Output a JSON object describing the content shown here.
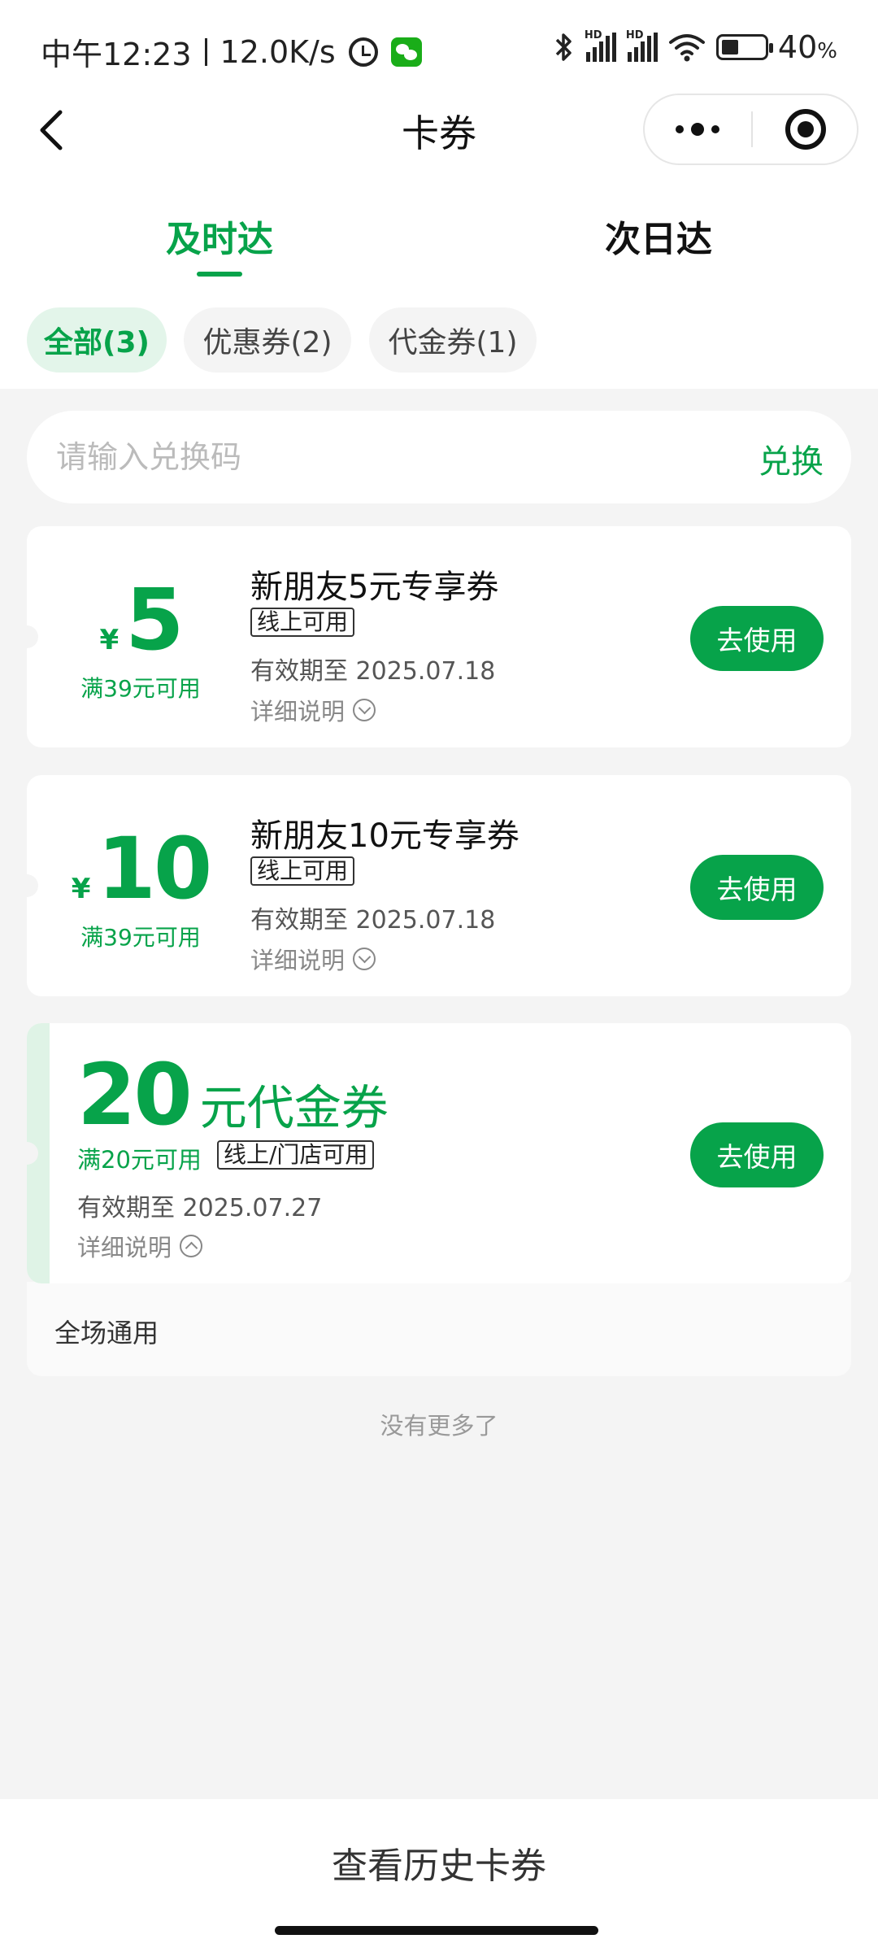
{
  "status_bar": {
    "time": "中午12:23",
    "speed": "12.0K/s",
    "hd": "HD",
    "battery_value": "40",
    "battery_unit": "%"
  },
  "nav": {
    "title": "卡券"
  },
  "tabs": [
    {
      "label": "及时达",
      "active": true
    },
    {
      "label": "次日达",
      "active": false
    }
  ],
  "filters": [
    {
      "label": "全部(3)",
      "active": true
    },
    {
      "label": "优惠券(2)",
      "active": false
    },
    {
      "label": "代金券(1)",
      "active": false
    }
  ],
  "redeem": {
    "placeholder": "请输入兑换码",
    "button": "兑换"
  },
  "coupons": [
    {
      "currency": "¥",
      "amount": "5",
      "condition": "满39元可用",
      "title": "新朋友5元专享券",
      "tag": "线上可用",
      "expiry": "有效期至 2025.07.18",
      "detail": "详细说明",
      "button": "去使用"
    },
    {
      "currency": "¥",
      "amount": "10",
      "condition": "满39元可用",
      "title": "新朋友10元专享券",
      "tag": "线上可用",
      "expiry": "有效期至 2025.07.18",
      "detail": "详细说明",
      "button": "去使用"
    }
  ],
  "voucher": {
    "amount": "20",
    "unit": "元代金券",
    "condition": "满20元可用",
    "tag": "线上/门店可用",
    "expiry": "有效期至 2025.07.27",
    "detail": "详细说明",
    "button": "去使用",
    "footer": "全场通用"
  },
  "no_more": "没有更多了",
  "bottom": {
    "history_label": "查看历史卡券"
  },
  "colors": {
    "accent": "#07a34a",
    "accent_light": "#e3f5ea",
    "background": "#f4f4f4"
  }
}
